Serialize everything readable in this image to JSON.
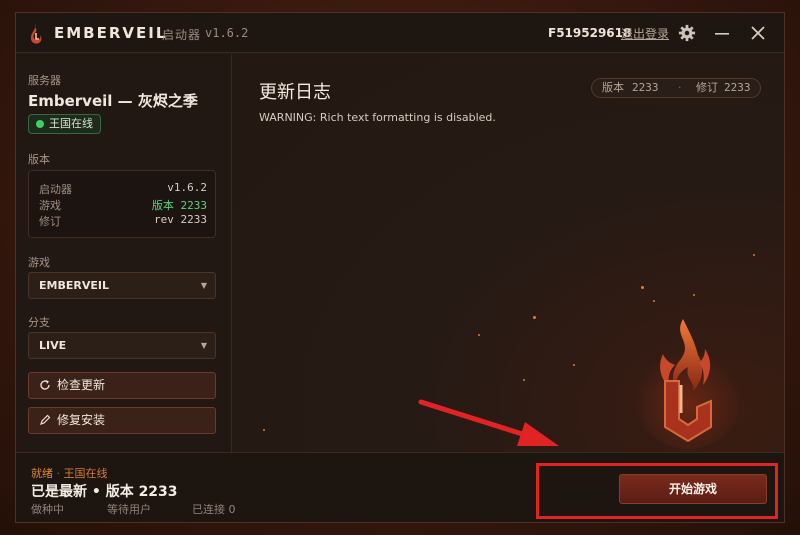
{
  "titlebar": {
    "app_name": "EMBERVEIL",
    "launcher_label": "启动器",
    "launcher_version": "v1.6.2",
    "user_id": "F519529618",
    "logout": "退出登录"
  },
  "sidebar": {
    "server_label": "服务器",
    "server_name": "Emberveil — 灰烬之季",
    "server_status": "王国在线",
    "version_label": "版本",
    "versions": {
      "launcher_key": "启动器",
      "launcher_val": "v1.6.2",
      "game_key": "游戏",
      "game_val": "版本 2233",
      "revision_key": "修订",
      "revision_val": "rev 2233"
    },
    "game_label": "游戏",
    "game_selected": "EMBERVEIL",
    "branch_label": "分支",
    "branch_selected": "LIVE",
    "check_updates": "检查更新",
    "repair_install": "修复安装"
  },
  "main": {
    "title": "更新日志",
    "warning": "WARNING: Rich text formatting is disabled.",
    "version_pill": {
      "version_key": "版本",
      "version_val": "2233",
      "revision_key": "修订",
      "revision_val": "2233"
    }
  },
  "footer": {
    "status_ready": "就绪",
    "status_online": "王国在线",
    "headline": "已是最新 • 版本 2233",
    "sub_seeding": "做种中",
    "sub_waiting": "等待用户",
    "sub_connected": "已连接 0",
    "play_button": "开始游戏"
  },
  "colors": {
    "accent": "#e0883a",
    "status_green": "#3fd06a",
    "highlight_red": "#e02323"
  }
}
